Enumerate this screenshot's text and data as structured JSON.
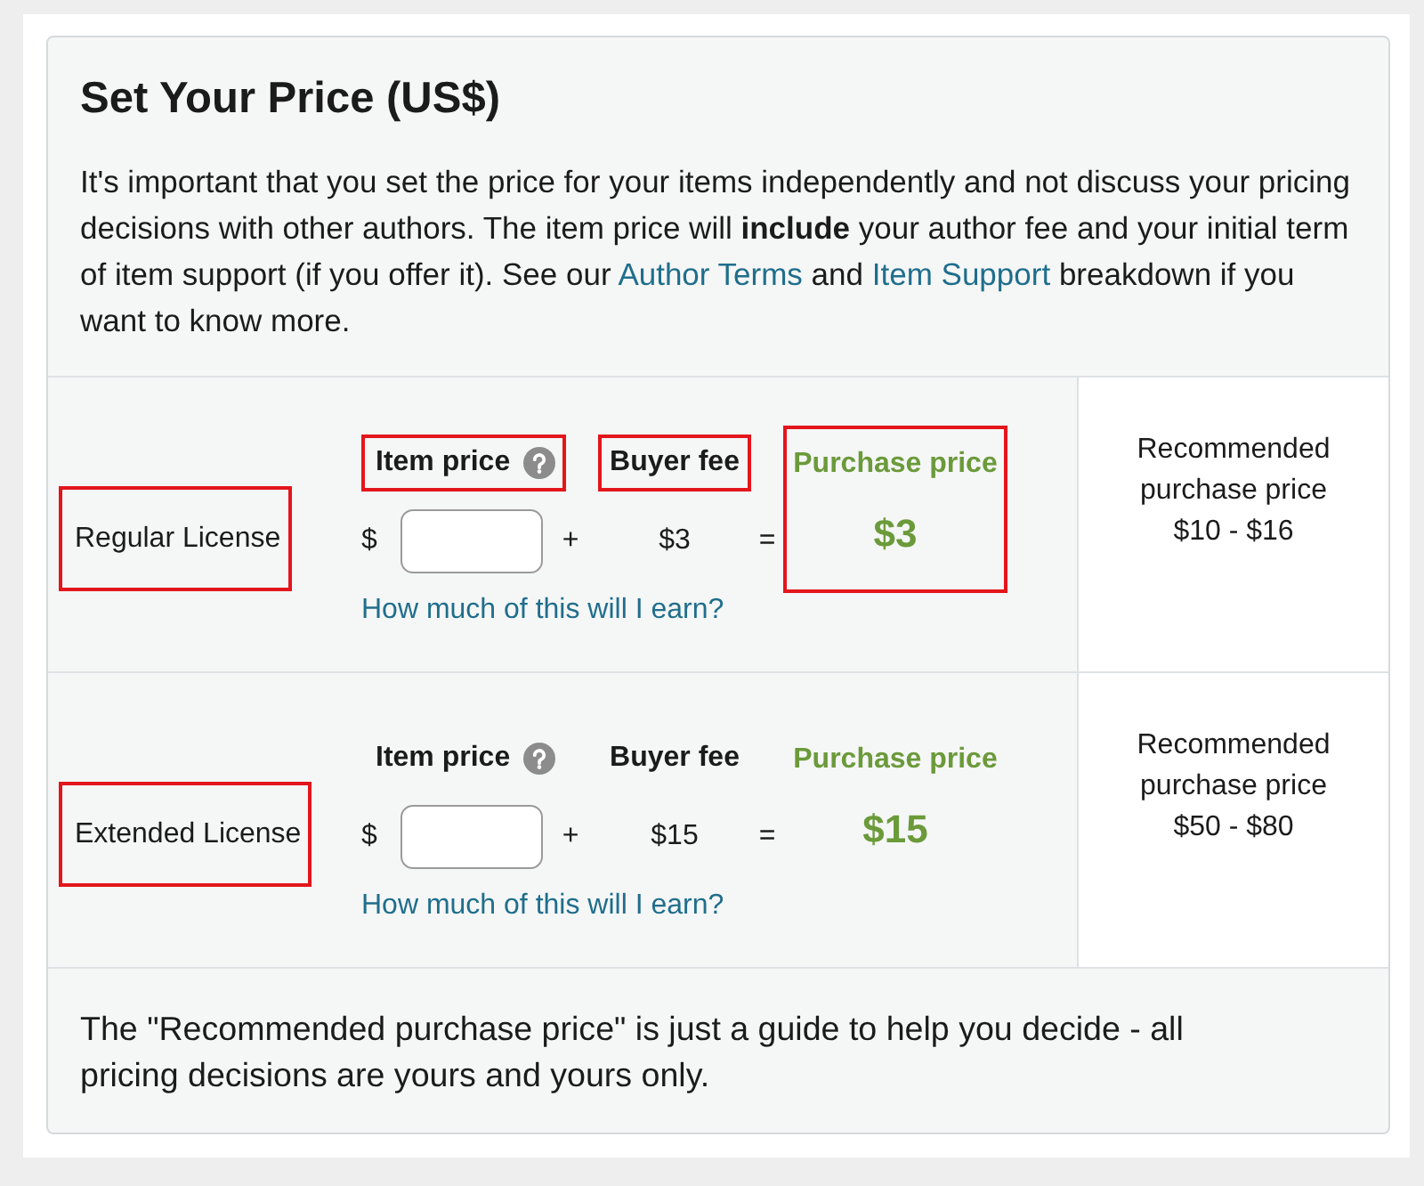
{
  "title": "Set Your Price (US$)",
  "intro": [
    {
      "kind": "text",
      "text": "It's important that you set the price for your items independently and not discuss your pricing decisions with other authors. The item price will **include** your author fee and your initial term of item support (if you offer it). See our "
    },
    {
      "kind": "link",
      "text": "Author Terms"
    },
    {
      "kind": "text",
      "text": " and "
    },
    {
      "kind": "link",
      "text": "Item Support"
    },
    {
      "kind": "text",
      "text": " breakdown if you want to know more."
    }
  ],
  "licenses": [
    {
      "name": {
        "text": "Regular License",
        "highlighted": true
      },
      "item_price": {
        "label": "Item price",
        "highlighted": true,
        "currency": "$"
      },
      "plus": "+",
      "buyer_fee": {
        "label": "Buyer fee",
        "highlighted": true,
        "amount": "$3"
      },
      "equals": "=",
      "purchase_price": {
        "label": "Purchase price",
        "highlighted": true,
        "amount": "$3"
      },
      "earn_link": "How much of this will I earn?",
      "recommended": {
        "label": "Recommended purchase price",
        "range": "$10 - $16"
      }
    },
    {
      "name": {
        "text": "Extended License",
        "highlighted": true
      },
      "item_price": {
        "label": "Item price",
        "highlighted": false,
        "currency": "$"
      },
      "plus": "+",
      "buyer_fee": {
        "label": "Buyer fee",
        "highlighted": false,
        "amount": "$15"
      },
      "equals": "=",
      "purchase_price": {
        "label": "Purchase price",
        "highlighted": false,
        "amount": "$15"
      },
      "earn_link": "How much of this will I earn?",
      "recommended": {
        "label": "Recommended purchase price",
        "range": "$50 - $80"
      }
    }
  ],
  "footer": "The \"Recommended purchase price\" is just a guide to help you decide - all pricing decisions are yours and yours only."
}
